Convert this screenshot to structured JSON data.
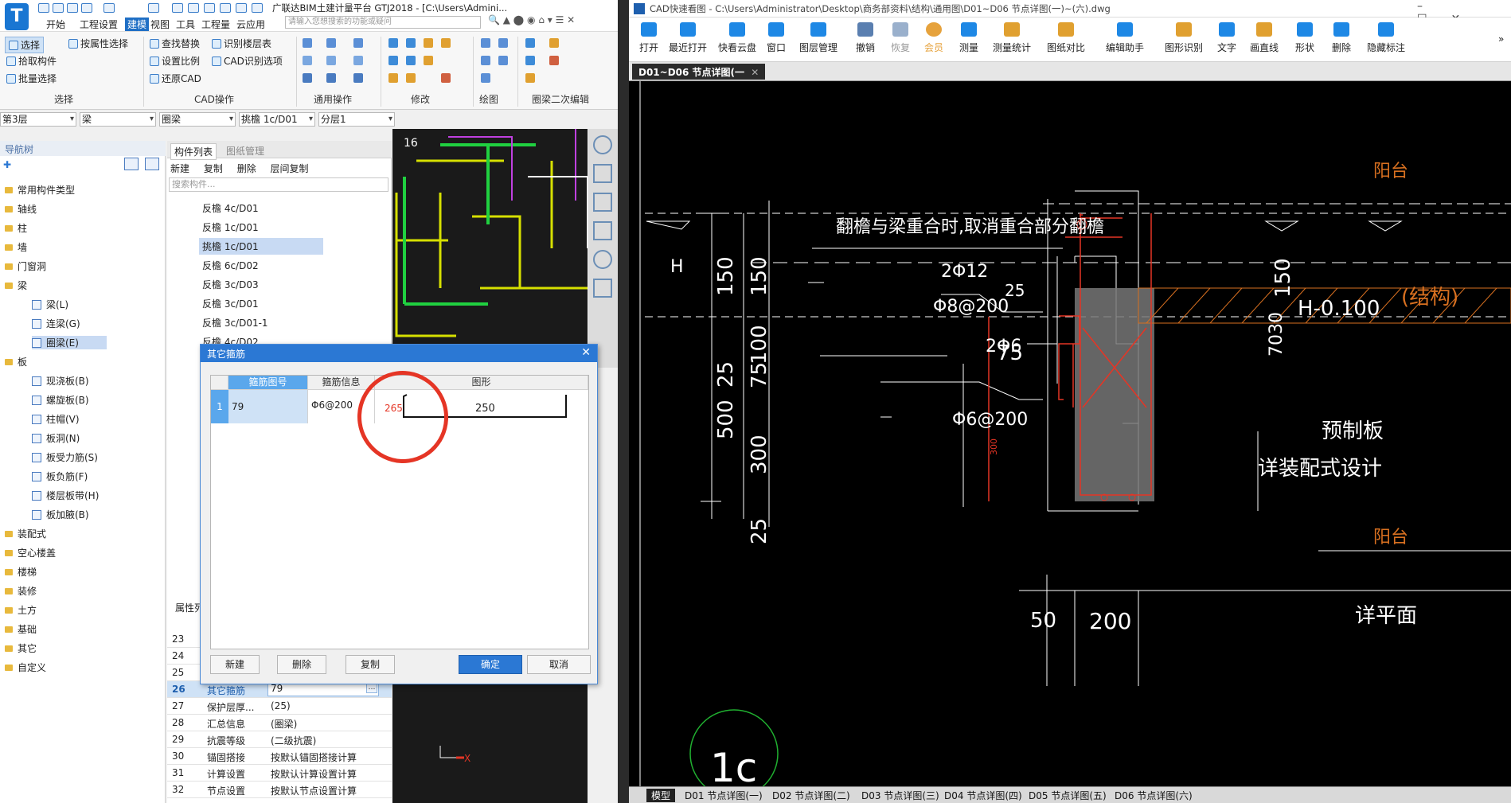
{
  "left_app": {
    "title": "广联达BIM土建计量平台 GTJ2018 - [C:\\Users\\Admini...",
    "menu": [
      "开始",
      "工程设置",
      "建模",
      "视图",
      "工具",
      "工程量",
      "云应用"
    ],
    "search_placeholder": "请输入您想搜索的功能或疑问",
    "ribbon": {
      "select": "选择",
      "by_attr": "按属性选择",
      "pick": "拾取构件",
      "batch": "批量选择",
      "find_replace": "查找替换",
      "set_scale": "设置比例",
      "restore_cad": "还原CAD",
      "recognize_floor": "识别楼层表",
      "cad_options": "CAD识别选项",
      "groups": [
        "选择",
        "CAD操作",
        "通用操作",
        "修改",
        "绘图",
        "圈梁二次编辑"
      ]
    },
    "combos": [
      "第3层",
      "梁",
      "圈梁",
      "挑檐 1c/D01",
      "分层1"
    ],
    "nav": {
      "header": "导航树",
      "items": [
        "常用构件类型",
        "轴线",
        "柱",
        "墙",
        "门窗洞",
        "梁",
        "梁(L)",
        "连梁(G)",
        "圈梁(E)",
        "板",
        "现浇板(B)",
        "螺旋板(B)",
        "柱帽(V)",
        "板洞(N)",
        "板受力筋(S)",
        "板负筋(F)",
        "楼层板带(H)",
        "板加腋(B)",
        "装配式",
        "空心楼盖",
        "楼梯",
        "装修",
        "土方",
        "基础",
        "其它",
        "自定义"
      ]
    },
    "component": {
      "tabs": [
        "构件列表",
        "图纸管理"
      ],
      "toolbar": [
        "新建",
        "复制",
        "删除",
        "层间复制"
      ],
      "search_placeholder": "搜索构件...",
      "items": [
        "反檐 4c/D01",
        "反檐 1c/D01",
        "挑檐 1c/D01",
        "反檐 6c/D02",
        "反檐 3c/D03",
        "反檐 3c/D01",
        "反檐 3c/D01-1",
        "反檐 4c/D02"
      ]
    },
    "props": {
      "header": "属性列",
      "rows": [
        {
          "no": "23",
          "name": "",
          "value": ""
        },
        {
          "no": "24",
          "name": "",
          "value": ""
        },
        {
          "no": "25",
          "name": "",
          "value": ""
        },
        {
          "no": "26",
          "name": "其它箍筋",
          "value": "79"
        },
        {
          "no": "27",
          "name": "保护层厚...",
          "value": "(25)"
        },
        {
          "no": "28",
          "name": "汇总信息",
          "value": "(圈梁)"
        },
        {
          "no": "29",
          "name": "抗震等级",
          "value": "(二级抗震)"
        },
        {
          "no": "30",
          "name": "锚固搭接",
          "value": "按默认锚固搭接计算"
        },
        {
          "no": "31",
          "name": "计算设置",
          "value": "按默认计算设置计算"
        },
        {
          "no": "32",
          "name": "节点设置",
          "value": "按默认节点设置计算"
        }
      ]
    },
    "dialog": {
      "title": "其它箍筋",
      "headers": [
        "箍筋图号",
        "箍筋信息",
        "图形"
      ],
      "row": {
        "no": "1",
        "code": "79",
        "info": "Φ6@200",
        "dim_left": "265",
        "dim_main": "250"
      },
      "buttons": [
        "新建",
        "删除",
        "复制",
        "确定",
        "取消"
      ]
    },
    "colors": {
      "accent": "#2b78d4",
      "circle": "#e53525"
    }
  },
  "right_app": {
    "title": "CAD快速看图 - C:\\Users\\Administrator\\Desktop\\商务部资料\\结构\\通用图\\D01~D06 节点详图(一)~(六).dwg",
    "toolbar": [
      "打开",
      "最近打开",
      "快看云盘",
      "窗口",
      "图层管理",
      "撤销",
      "恢复",
      "会员",
      "测量",
      "测量统计",
      "图纸对比",
      "编辑助手",
      "图形识别",
      "文字",
      "画直线",
      "形状",
      "删除",
      "隐藏标注"
    ],
    "doc_tab": "D01~D06 节点详图(一",
    "drawing": {
      "note": "翻檐与梁重合时,取消重合部分翻檐",
      "rebar1": "2Φ12",
      "rebar2": "Φ8@200",
      "rebar3": "2Φ6",
      "rebar4": "Φ6@200",
      "h_label": "H",
      "h_minus": "H-0.100",
      "prefab": "预制板",
      "assembled": "详装配式设计",
      "balcony": "阳台",
      "structure": "(结构)",
      "plan": "详平面",
      "dims": {
        "d150a": "150",
        "d150b": "150",
        "d25": "25",
        "d75": "75",
        "d100": "100",
        "d25b": "25",
        "d500": "500",
        "d300": "300",
        "d25c": "25",
        "d150c": "150",
        "d30": "30",
        "d70": "70",
        "d50": "50",
        "d200": "200",
        "d300s": "300"
      },
      "detail_id": "1c"
    },
    "bottom_tabs": [
      "模型",
      "D01 节点详图(一)",
      "D02 节点详图(二)",
      "D03 节点详图(三)",
      "D04 节点详图(四)",
      "D05 节点详图(五)",
      "D06 节点详图(六)"
    ]
  }
}
